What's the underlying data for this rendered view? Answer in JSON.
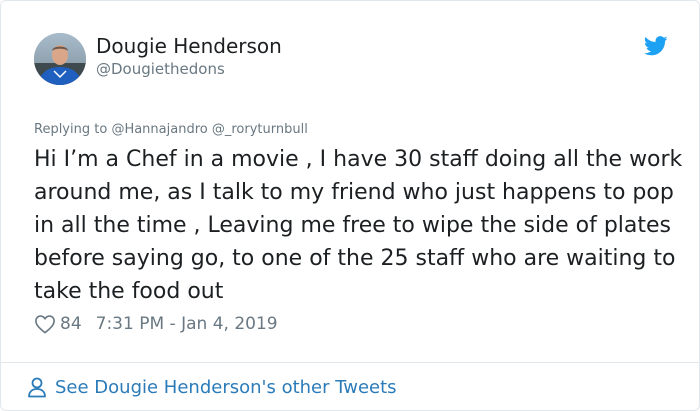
{
  "author": {
    "display_name": "Dougie Henderson",
    "handle": "@Dougiethedons",
    "avatar_icon": "user-photo"
  },
  "reply": {
    "prefix": "Replying to",
    "mentions": [
      "@Hannajandro",
      "@_roryturnbull"
    ]
  },
  "tweet": {
    "text": "Hi I’m a Chef in a movie , I have 30 staff doing all the work around me, as I talk to my friend who just happens to pop in all the time , Leaving me free to wipe the side of plates before saying go, to one of the 25 staff who are waiting to take the food out",
    "likes": "84",
    "timestamp": "7:31 PM - Jan 4, 2019"
  },
  "footer": {
    "link_text": "See Dougie Henderson's other Tweets"
  },
  "icons": {
    "brand": "twitter-bird-icon",
    "like": "heart-icon",
    "profile": "person-icon"
  },
  "colors": {
    "twitter_blue": "#1da1f2",
    "link_blue": "#2b7bb9",
    "text": "#1c2022",
    "muted": "#697882",
    "border": "#e1e8ed"
  }
}
